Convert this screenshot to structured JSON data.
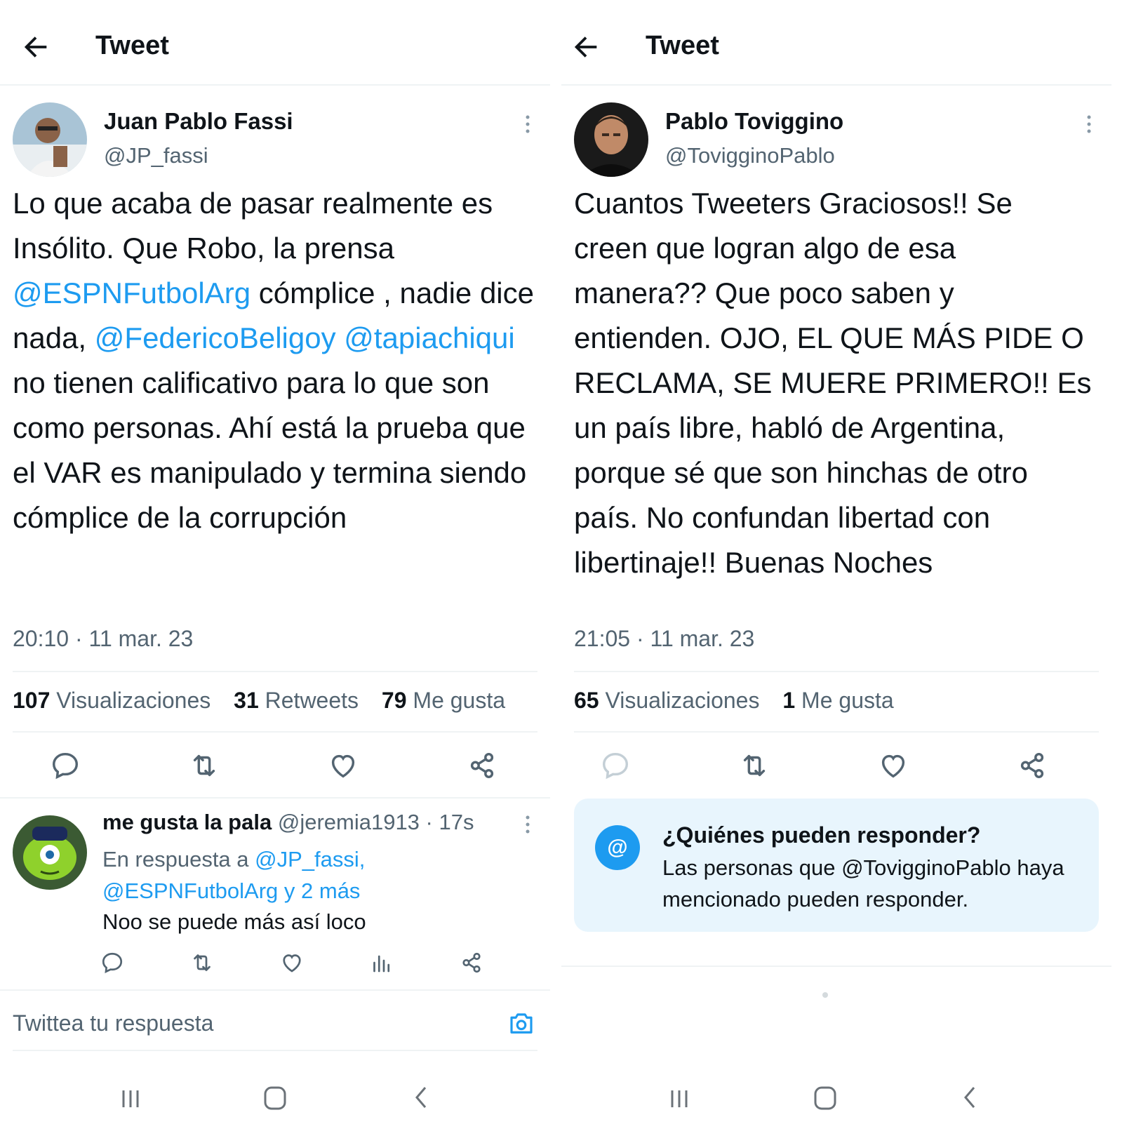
{
  "left": {
    "header": {
      "title": "Tweet"
    },
    "tweet": {
      "name": "Juan Pablo Fassi",
      "handle": "@JP_fassi",
      "text": {
        "p1": "Lo que acaba de pasar realmente es Insólito. Que Robo, la prensa ",
        "m1": "@ESPNFutbolArg",
        "p2": " cómplice , nadie dice nada, ",
        "m2": "@FedericoBeligoy",
        "p3": " ",
        "m3": "@tapiachiqui",
        "p4": " no tienen calificativo para lo que son como personas. Ahí está la prueba que el VAR es manipulado y termina siendo cómplice de la corrupción"
      },
      "timestamp": "20:10 · 11 mar. 23",
      "stats": [
        {
          "num": "107",
          "label": "Visualizaciones"
        },
        {
          "num": "31",
          "label": "Retweets"
        },
        {
          "num": "79",
          "label": "Me gusta"
        }
      ]
    },
    "reply": {
      "name": "me gusta la pala",
      "handle_time": "@jeremia1913 · 17s",
      "reply_to_prefix": "En respuesta a ",
      "reply_to_links": "@JP_fassi, @ESPNFutbolArg y 2 más",
      "text": "Noo se puede más así loco"
    },
    "compose": {
      "placeholder": "Twittea tu respuesta"
    }
  },
  "right": {
    "header": {
      "title": "Tweet"
    },
    "tweet": {
      "name": "Pablo Toviggino",
      "handle": "@TovigginoPablo",
      "text": "Cuantos Tweeters Graciosos!! Se creen que logran algo de esa manera?? Que poco saben y entienden. OJO, EL QUE MÁS PIDE O RECLAMA, SE MUERE PRIMERO!! Es un país libre, habló de Argentina, porque sé que son hinchas de otro país. No confundan libertad con libertinaje!! Buenas Noches",
      "timestamp": "21:05 · 11 mar. 23",
      "stats": [
        {
          "num": "65",
          "label": "Visualizaciones"
        },
        {
          "num": "1",
          "label": "Me gusta"
        }
      ]
    },
    "who_can_reply": {
      "icon": "@",
      "title": "¿Quiénes pueden responder?",
      "text": "Las personas que @TovigginoPablo haya mencionado pueden responder."
    }
  },
  "colors": {
    "accent": "#1d9bf0",
    "secondary_text": "#536471",
    "primary_text": "#0f1419",
    "info_bg": "#e8f5fd"
  },
  "icons": [
    "back-arrow-icon",
    "more-vertical-icon",
    "reply-icon",
    "retweet-icon",
    "like-icon",
    "share-icon",
    "views-icon",
    "camera-icon",
    "at-icon",
    "nav-recents-icon",
    "nav-home-icon",
    "nav-back-icon"
  ]
}
